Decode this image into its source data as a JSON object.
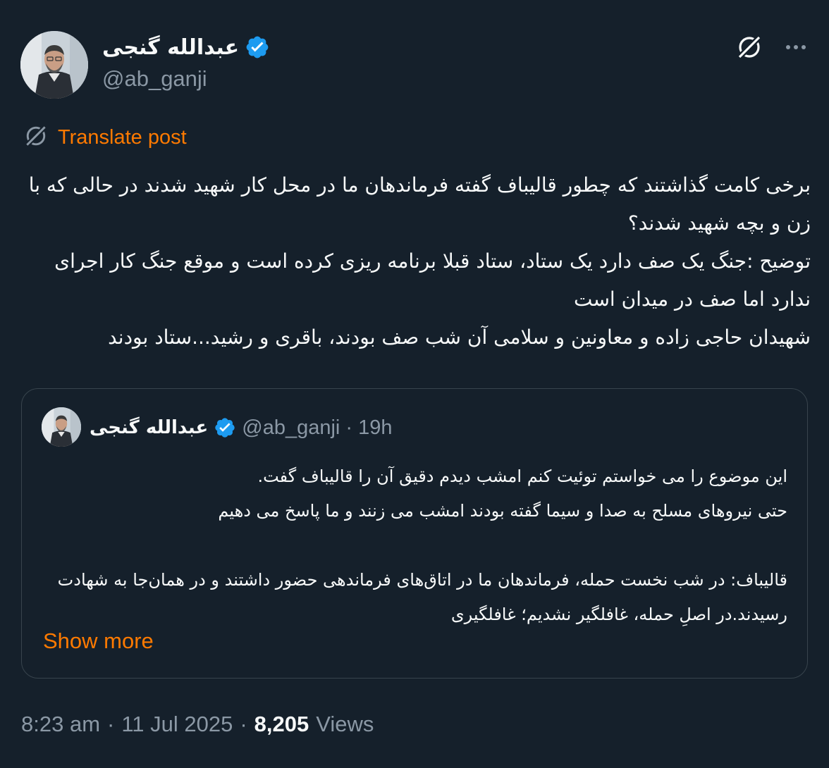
{
  "author": {
    "name": "عبدالله گنجی",
    "handle": "@ab_ganji",
    "verified": true,
    "verified_color": "#1d9bf0"
  },
  "actions": {
    "grok_icon": "grok-icon",
    "more_icon": "more-horizontal-icon",
    "more_label": "···"
  },
  "translate": {
    "label": "Translate post",
    "icon": "grok-icon",
    "color": "#ff7a00"
  },
  "post": {
    "lines": [
      "برخی کامت گذاشتند که چطور قالیباف گفته فرماندهان ما در محل کار شهید شدند در حالی که با زن و بچه شهید شدند؟",
      "توضیح :جنگ یک صف دارد یک ستاد، ستاد قبلا برنامه ریزی کرده است و موقع جنگ کار اجرای ندارد اما صف در میدان است",
      "شهیدان حاجی زاده و معاونین و سلامی آن شب صف بودند، باقری و رشید...ستاد بودند"
    ]
  },
  "quote": {
    "name": "عبدالله گنجی",
    "handle": "@ab_ganji",
    "separator": "·",
    "time": "19h",
    "lines": [
      "این موضوع را می خواستم توئیت کنم امشب دیدم دقیق آن را قالیباف گفت.",
      "حتی نیروهای مسلح به صدا و سیما گفته بودند امشب می زنند و ما پاسخ می دهیم",
      "",
      "قالیباف: در شب نخست حمله، فرماندهان ما در اتاق‌های فرماندهی حضور داشتند و در همان‌جا به شهادت رسیدند.در اصلِ حمله، غافلگیر نشدیم؛ غافلگیری"
    ],
    "show_more": "Show more"
  },
  "meta": {
    "time": "8:23 am",
    "separator": "·",
    "date": "11 Jul 2025",
    "separator2": "·",
    "views_count": "8,205",
    "views_label": "Views"
  },
  "colors": {
    "background": "#15202b",
    "text": "#f7f9f9",
    "secondary": "#8b98a5",
    "accent": "#ff7a00",
    "border": "#38444d"
  }
}
